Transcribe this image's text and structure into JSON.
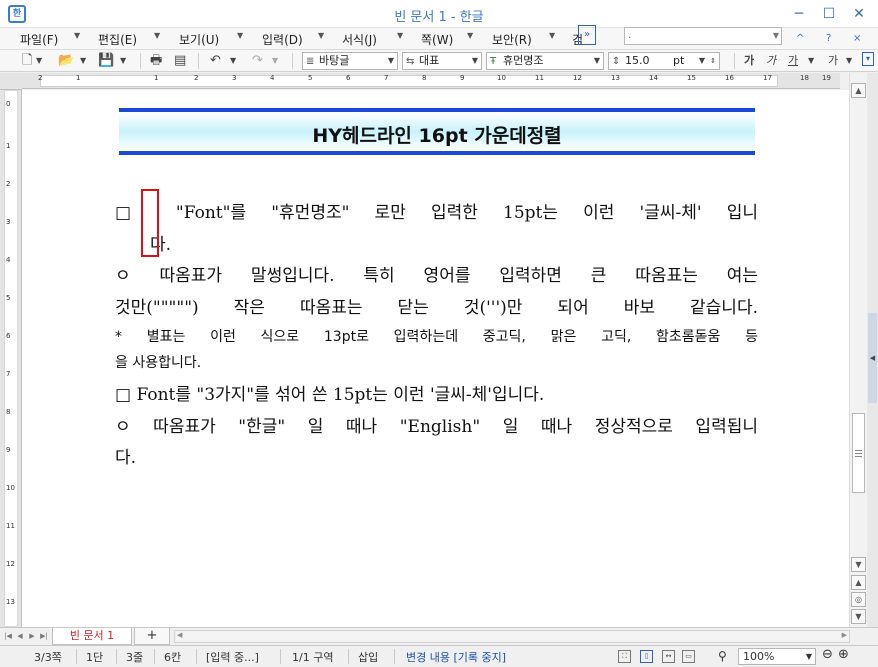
{
  "window": {
    "title": "빈 문서 1 - 한글",
    "app_icon": "hangul-app-icon",
    "minimize": "─",
    "maximize": "☐",
    "close": "✕"
  },
  "menu": {
    "items": [
      "파일(F)",
      "편집(E)",
      "보기(U)",
      "입력(D)",
      "서식(J)",
      "쪽(W)",
      "보안(R)",
      "검"
    ],
    "more_label": "»",
    "search_value": ".",
    "collapse_label": "^",
    "help_label": "?",
    "close_doc_label": "×"
  },
  "toolbar": {
    "style_combo": "바탕글",
    "lang_combo": "대표",
    "font_combo": "휴먼명조",
    "size_value": "15.0",
    "size_unit": "pt",
    "bold_label": "가",
    "italic_label": "가",
    "underline_label": "가",
    "strike_label": "가"
  },
  "ruler": {
    "h_ticks": [
      "2",
      "1",
      "1",
      "2",
      "3",
      "4",
      "5",
      "6",
      "7",
      "8",
      "9",
      "10",
      "11",
      "12",
      "13",
      "14",
      "15",
      "16",
      "17",
      "18",
      "19"
    ],
    "v_ticks": [
      "0",
      "1",
      "2",
      "3",
      "4",
      "5",
      "6",
      "7",
      "8",
      "9",
      "10",
      "11",
      "12",
      "13"
    ]
  },
  "document": {
    "banner_title": "HY헤드라인 16pt 가운데정렬",
    "paragraphs": [
      "□ \"Font\"를 \"휴먼명조\" 로만 입력한 15pt는 이런 '글씨-체' 입니",
      "다.",
      "ㅇ 따옴표가 말썽입니다. 특히 영어를 입력하면 큰 따옴표는 여는",
      "것만(\"\"\"\"\") 작은 따옴표는 닫는 것(''')만 되어 바보 같습니다.",
      "* 별표는 이런 식으로 13pt로 입력하는데 중고딕, 맑은 고딕, 함초롬돋움 등",
      "을 사용합니다.",
      "□ Font를 \"3가지\"를 섞어 쓴 15pt는 이런 '글씨-체'입니다.",
      "ㅇ 따옴표가 \"한글\" 일 때나 \"English\" 일 때나 정상적으로 입력됩니",
      "다."
    ]
  },
  "tabs": {
    "doc_tab": "빈 문서 1",
    "add_tab": "+"
  },
  "status": {
    "page": "3/3쪽",
    "column": "1단",
    "line": "3줄",
    "col_pos": "6칸",
    "input_mode": "[입력 중...]",
    "section": "1/1 구역",
    "insert_mode": "삽입",
    "track_changes": "변경 내용 [기록 중지]",
    "zoom": "100%"
  }
}
